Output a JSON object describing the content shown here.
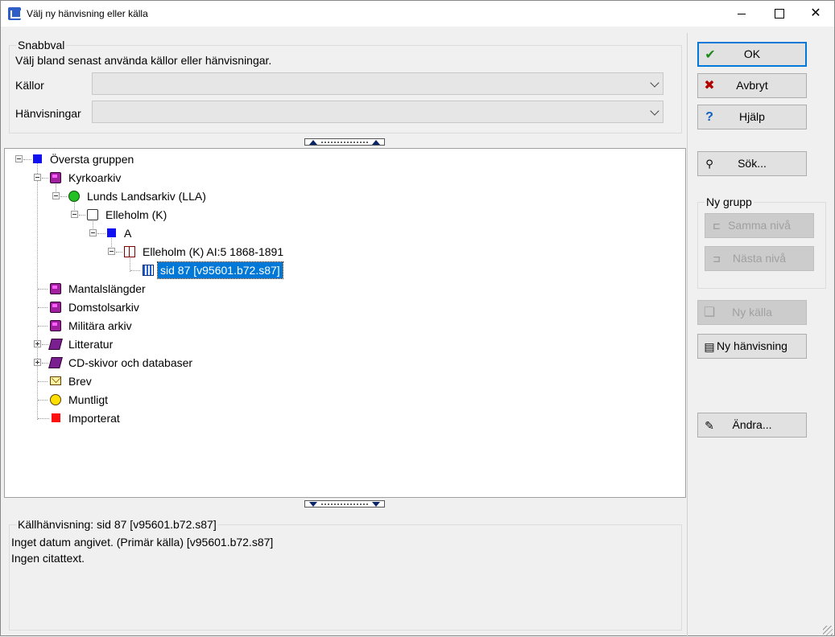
{
  "window": {
    "title": "Välj ny hänvisning eller källa",
    "controls": {
      "minimize": "",
      "maximize": "",
      "close": "✕"
    }
  },
  "snabbval": {
    "legend": "Snabbval",
    "description": "Välj bland senast använda källor eller hänvisningar.",
    "kallor_label": "Källor",
    "kallor_value": "",
    "hanvisningar_label": "Hänvisningar",
    "hanvisningar_value": ""
  },
  "tree": {
    "nodes": [
      {
        "label": "Översta gruppen",
        "icon": "blue-square-icon"
      },
      {
        "label": "Kyrkoarkiv",
        "icon": "archive-icon"
      },
      {
        "label": "Lunds Landsarkiv (LLA)",
        "icon": "globe-icon"
      },
      {
        "label": "Elleholm (K)",
        "icon": "hand-icon"
      },
      {
        "label": "A",
        "icon": "blue-square-icon"
      },
      {
        "label": "Elleholm (K) AI:5 1868-1891",
        "icon": "open-book-icon"
      },
      {
        "label": "sid 87 [v95601.b72.s87]",
        "icon": "page-icon",
        "selected": true
      },
      {
        "label": "Mantalslängder",
        "icon": "archive-icon"
      },
      {
        "label": "Domstolsarkiv",
        "icon": "archive-icon"
      },
      {
        "label": "Militära arkiv",
        "icon": "archive-icon"
      },
      {
        "label": "Litteratur",
        "icon": "book-icon"
      },
      {
        "label": "CD-skivor och databaser",
        "icon": "book-icon"
      },
      {
        "label": "Brev",
        "icon": "envelope-icon"
      },
      {
        "label": "Muntligt",
        "icon": "face-icon"
      },
      {
        "label": "Importerat",
        "icon": "red-square-icon"
      }
    ]
  },
  "info": {
    "legend": "Källhänvisning: sid 87 [v95601.b72.s87]",
    "line1": "Inget datum angivet. (Primär källa) [v95601.b72.s87]",
    "line2": "Ingen citattext."
  },
  "buttons": {
    "ok": "OK",
    "avbryt": "Avbryt",
    "hjalp": "Hjälp",
    "sok": "Sök...",
    "ny_grupp_legend": "Ny grupp",
    "samma_niva": "Samma nivå",
    "nasta_niva": "Nästa nivå",
    "ny_kalla": "Ny källa",
    "ny_hanvisning": "Ny hänvisning",
    "andra": "Ändra..."
  },
  "colors": {
    "accent": "#0078d7",
    "selection": "#0078d7",
    "ok_check": "#1c8a1c",
    "cancel_cross": "#b00000"
  }
}
